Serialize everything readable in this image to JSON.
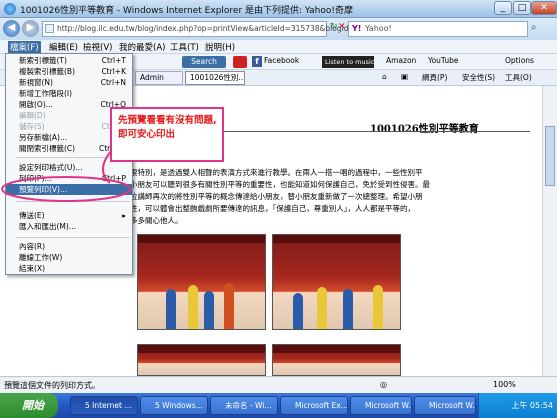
{
  "window": {
    "title": "1001026性別平等教育 - Windows Internet Explorer 是由下列提供: Yahoo!奇摩"
  },
  "address": {
    "url": "http://blog.ilc.edu.tw/blog/index.php?op=printView&articleId=315738&blogId="
  },
  "search": {
    "placeholder": "Yahoo!",
    "engine_label": "Search"
  },
  "menubar": {
    "items": [
      "檔案(F)",
      "編輯(E)",
      "檢視(V)",
      "我的最愛(A)",
      "工具(T)",
      "說明(H)"
    ]
  },
  "toolbar": {
    "facebook": "Facebook",
    "listen": "Listen to music",
    "amazon": "Amazon",
    "youtube": "YouTube",
    "options": "Options",
    "admin_tab": "Admin",
    "page_tab": "1001026性別...",
    "webpage": "網頁(P)",
    "safety": "安全性(S)",
    "tools": "工具(O)"
  },
  "file_menu": {
    "items": [
      {
        "label": "新索引標籤(T)",
        "shortcut": "Ctrl+T"
      },
      {
        "label": "複製索引標籤(B)",
        "shortcut": "Ctrl+K"
      },
      {
        "label": "新視窗(N)",
        "shortcut": "Ctrl+N"
      },
      {
        "label": "新增工作階段(I)",
        "shortcut": ""
      },
      {
        "label": "開啟(O)...",
        "shortcut": "Ctrl+O"
      },
      {
        "label": "編輯(D)",
        "shortcut": ""
      },
      {
        "label": "儲存(S)",
        "shortcut": "Ctrl+S"
      },
      {
        "label": "另存新檔(A)...",
        "shortcut": ""
      },
      {
        "label": "關閉索引標籤(C)",
        "shortcut": "Ctrl+W"
      },
      {
        "label": "設定列印格式(U)...",
        "shortcut": ""
      },
      {
        "label": "列印(P)...",
        "shortcut": "Ctrl+P"
      },
      {
        "label": "預覽列印(V)...",
        "shortcut": ""
      },
      {
        "label": "傳送(E)",
        "shortcut": ""
      },
      {
        "label": "匯入和匯出(M)...",
        "shortcut": ""
      },
      {
        "label": "內容(R)",
        "shortcut": ""
      },
      {
        "label": "離線工作(W)",
        "shortcut": ""
      },
      {
        "label": "結束(X)",
        "shortcut": ""
      }
    ]
  },
  "callout": {
    "text": "先預覽看看有沒有問題,即可安心印出"
  },
  "article": {
    "title": "1001026性別平等教育",
    "lines": [
      "很特別，是透過雙人相聲的表演方式來進行教學。在兩人一搭一唱的過程中，一些性別平",
      "小朋友可以聽到很多有關性別平等的重要性，也能知道如何保護自己，免於受到性侵害。最",
      "位講師再次的將性別平等的概念傳達給小朋友，替小朋友重新做了一次總整理。希望小朋",
      "性，可以體會出整齣戲劇所要傳達的訊息，「保護自己，尊重別人」，人人都是平等的，",
      "多多關心他人。"
    ]
  },
  "statusbar": {
    "text": "預覽這個文件的列印方式。",
    "zoom": "100%"
  },
  "taskbar": {
    "start": "開始",
    "tasks": [
      "5 Internet ...",
      "5 Windows...",
      "未命名 - Wi...",
      "Microsoft Ex...",
      "Microsoft W...",
      "Microsoft W..."
    ],
    "clock": "上午 05:54"
  }
}
